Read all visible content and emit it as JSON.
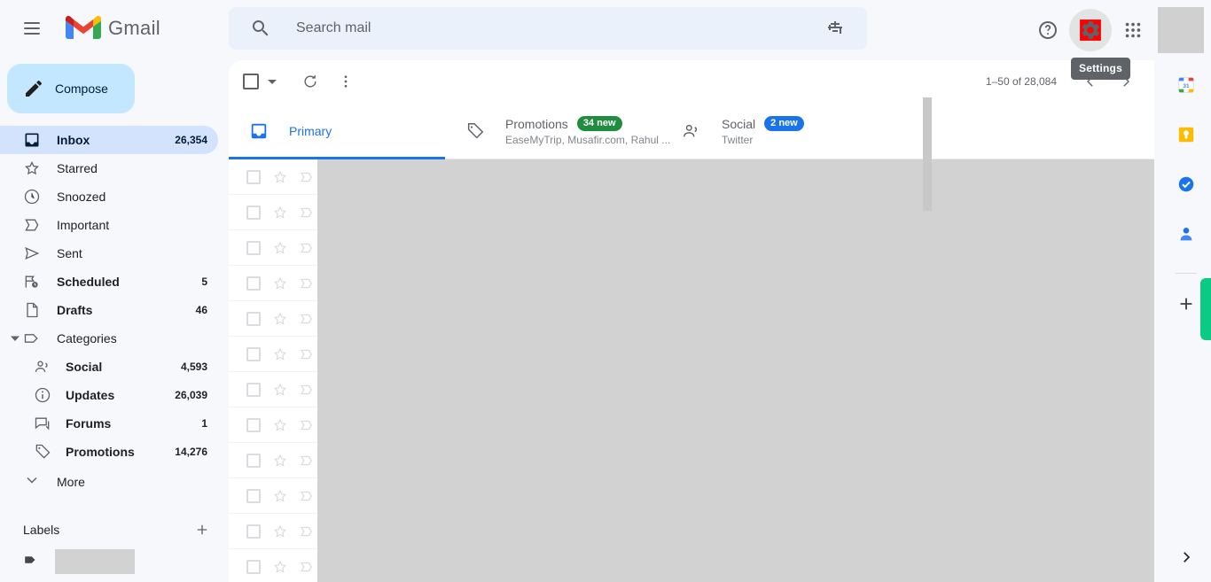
{
  "app": {
    "brand": "Gmail",
    "menu_icon": "hamburger-menu-icon",
    "logo_icon": "gmail-logo-icon"
  },
  "search": {
    "placeholder": "Search mail",
    "value": "",
    "icon": "search-icon",
    "options_icon": "search-options-icon"
  },
  "topright": {
    "help_icon": "help-icon",
    "settings_icon": "settings-gear-icon",
    "apps_icon": "google-apps-grid-icon",
    "avatar": "account-avatar",
    "tooltip": "Settings"
  },
  "sidebar": {
    "compose": {
      "label": "Compose",
      "icon": "pencil-compose-icon"
    },
    "items": [
      {
        "label": "Inbox",
        "count": "26,354",
        "icon": "inbox-icon",
        "active": true,
        "bold": true
      },
      {
        "label": "Starred",
        "count": "",
        "icon": "star-icon",
        "active": false,
        "bold": false
      },
      {
        "label": "Snoozed",
        "count": "",
        "icon": "clock-icon",
        "active": false,
        "bold": false
      },
      {
        "label": "Important",
        "count": "",
        "icon": "important-icon",
        "active": false,
        "bold": false
      },
      {
        "label": "Sent",
        "count": "",
        "icon": "send-icon",
        "active": false,
        "bold": false
      },
      {
        "label": "Scheduled",
        "count": "5",
        "icon": "scheduled-icon",
        "active": false,
        "bold": true
      },
      {
        "label": "Drafts",
        "count": "46",
        "icon": "draft-icon",
        "active": false,
        "bold": true
      }
    ],
    "categories": {
      "label": "Categories",
      "icon": "label-tag-icon",
      "expanded": true,
      "items": [
        {
          "label": "Social",
          "count": "4,593",
          "icon": "people-icon"
        },
        {
          "label": "Updates",
          "count": "26,039",
          "icon": "info-icon"
        },
        {
          "label": "Forums",
          "count": "1",
          "icon": "forum-icon"
        },
        {
          "label": "Promotions",
          "count": "14,276",
          "icon": "tag-icon"
        }
      ]
    },
    "more": {
      "label": "More",
      "icon": "chevron-down-icon"
    },
    "labels": {
      "title": "Labels",
      "add_icon": "plus-icon",
      "rows": [
        {
          "icon": "label-tag-filled-icon"
        }
      ]
    }
  },
  "toolbar": {
    "select_all_icon": "checkbox-icon",
    "select_dropdown_icon": "chevron-down-icon",
    "refresh_icon": "refresh-icon",
    "more_icon": "more-vertical-icon",
    "pager_text": "1–50 of 28,084",
    "prev_icon": "chevron-left-icon",
    "next_icon": "chevron-right-icon"
  },
  "tabs": [
    {
      "label": "Primary",
      "icon": "inbox-tab-icon",
      "badge": "",
      "badge_color": "",
      "sub": "",
      "active": true
    },
    {
      "label": "Promotions",
      "icon": "tag-tab-icon",
      "badge": "34 new",
      "badge_color": "#1e8e3e",
      "sub": "EaseMyTrip, Musafir.com, Rahul ...",
      "active": false
    },
    {
      "label": "Social",
      "icon": "people-tab-icon",
      "badge": "2 new",
      "badge_color": "#1a73e8",
      "sub": "Twitter",
      "active": false
    }
  ],
  "maillist": {
    "row_count": 12,
    "checkbox_icon": "checkbox-icon",
    "star_icon": "star-outline-icon",
    "important_icon": "important-marker-icon",
    "loading_placeholder": "content-loading-skeleton"
  },
  "rail": {
    "items": [
      {
        "icon": "google-calendar-icon"
      },
      {
        "icon": "google-keep-icon"
      },
      {
        "icon": "google-tasks-icon"
      },
      {
        "icon": "google-contacts-icon"
      }
    ],
    "add_icon": "plus-add-apps-icon",
    "expand_icon": "chevron-right-expand-icon",
    "accent_color": "#0bca86"
  },
  "colors": {
    "accent_blue": "#1a73e8",
    "compose_bg": "#c2e7ff",
    "active_nav_bg": "#d3e3fd",
    "page_bg": "#f6f8fc",
    "search_bg": "#eaf1fb",
    "skeleton": "#d2d2d2"
  }
}
